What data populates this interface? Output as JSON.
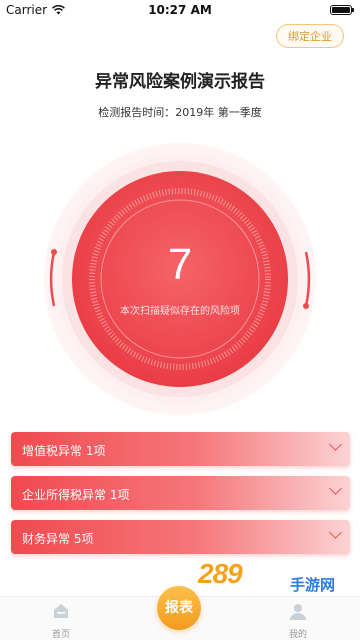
{
  "status_bar": {
    "carrier": "Carrier",
    "time": "10:27 AM"
  },
  "header": {
    "bind_button_label": "绑定企业"
  },
  "report": {
    "title": "异常风险案例演示报告",
    "period": "检测报告时间：2019年 第一季度"
  },
  "gauge": {
    "value": "7",
    "label": "本次扫描疑似存在的风险项"
  },
  "risk_items": [
    {
      "label": "增值税异常 1项"
    },
    {
      "label": "企业所得税异常 1项"
    },
    {
      "label": "财务异常 5项"
    }
  ],
  "watermark": {
    "logo_text": "289",
    "text": "手游网"
  },
  "tabbar": {
    "home_label": "首页",
    "report_label": "报表",
    "mine_label": "我的"
  },
  "colors": {
    "accent_red": "#f04a4f",
    "accent_orange": "#f49a1f",
    "bind_border": "#f3c77f"
  }
}
